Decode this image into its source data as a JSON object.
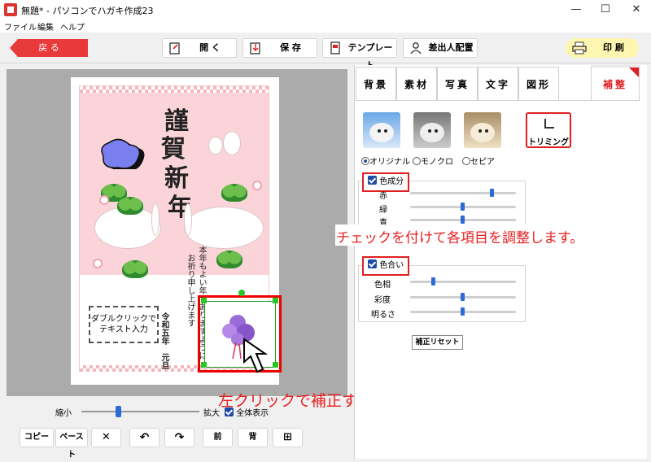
{
  "window": {
    "title": "無題* - パソコンでハガキ作成23",
    "min": "—",
    "max": "☐",
    "close": "✕"
  },
  "menu": [
    "ファイル",
    "編集",
    "ヘルプ"
  ],
  "toolbar": {
    "back": "戻 る",
    "open": "開 く",
    "save": "保 存",
    "template": "テンプレート",
    "sender": "差出人配置",
    "print": "印 刷"
  },
  "card": {
    "title_chars": [
      "謹",
      "賀",
      "新",
      "年"
    ],
    "message_lines": [
      "本年もよい年でありますように",
      "お祈り申し上げます"
    ],
    "date_lines": [
      "令和五年",
      "元旦"
    ],
    "text_box": "ダブルクリックで\nテキスト入力"
  },
  "zoom": {
    "min_label": "縮小",
    "max_label": "拡大",
    "fit_label": "全体表示",
    "fit_checked": true,
    "level": 0.29
  },
  "bottom_buttons": [
    "コピー",
    "ペースト",
    "✕",
    "↶",
    "↷",
    "前",
    "背",
    "⊞"
  ],
  "tabs": [
    {
      "label": "背景",
      "active": false
    },
    {
      "label": "素材",
      "active": false
    },
    {
      "label": "写真",
      "active": false
    },
    {
      "label": "文字",
      "active": false
    },
    {
      "label": "図形",
      "active": false
    },
    {
      "label": "補整",
      "active": true
    }
  ],
  "color_modes": {
    "options": [
      "オリジナル",
      "モノクロ",
      "セピア"
    ],
    "selected": "オリジナル",
    "trim_label": "トリミング"
  },
  "color_balance": {
    "label": "色成分",
    "checked": true,
    "sliders": [
      {
        "label": "赤",
        "value": 0.8
      },
      {
        "label": "緑",
        "value": 0.5
      },
      {
        "label": "青",
        "value": 0.5
      }
    ]
  },
  "tone": {
    "label": "色合い",
    "checked": true,
    "sliders": [
      {
        "label": "色相",
        "value": 0.2
      },
      {
        "label": "彩度",
        "value": 0.5
      },
      {
        "label": "明るさ",
        "value": 0.5
      }
    ]
  },
  "reset_label": "補正リセット",
  "annotations": {
    "tip_right": "チェックを付けて各項目を調整します。",
    "tip_bottom": "左クリックで補正する写真を選択"
  },
  "colors": {
    "accent_red": "#e02020",
    "back_button": "#e83a3a",
    "print_button": "#fdf6b0",
    "slider_thumb": "#2a6bd6",
    "selection_handle": "#28c728"
  }
}
